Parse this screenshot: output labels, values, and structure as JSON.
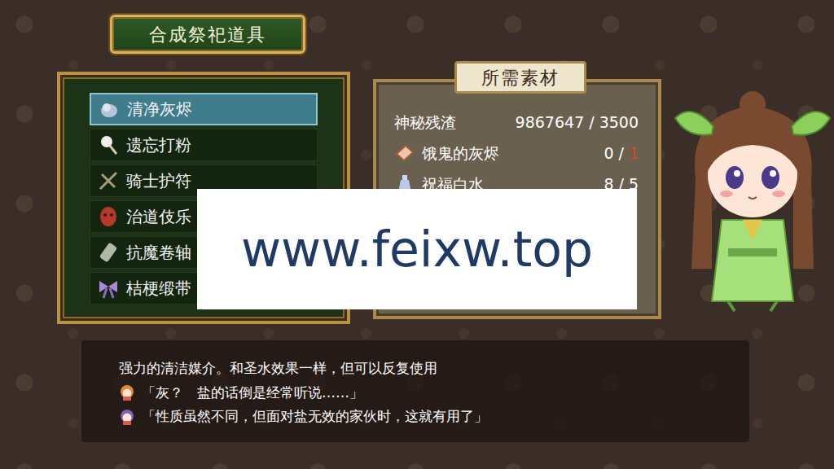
{
  "title": "合成祭祀道具",
  "recipes": [
    {
      "name": "清净灰烬",
      "selected": true
    },
    {
      "name": "遗忘打粉",
      "selected": false
    },
    {
      "name": "骑士护符",
      "selected": false
    },
    {
      "name": "治道伎乐",
      "selected": false
    },
    {
      "name": "抗魔卷轴",
      "selected": false
    },
    {
      "name": "桔梗缎带",
      "selected": false
    }
  ],
  "materials": {
    "title": "所需素材",
    "separator": "/",
    "items": [
      {
        "name": "神秘残渣",
        "kind": "currency",
        "have": "9867647",
        "need": "3500",
        "enough": true
      },
      {
        "name": "饿鬼的灰烬",
        "kind": "item",
        "have": "0",
        "need": "1",
        "enough": false
      },
      {
        "name": "祝福白水",
        "kind": "item",
        "have": "8",
        "need": "5",
        "enough": true
      }
    ]
  },
  "description": {
    "text": "强力的清洁媒介。和圣水效果一样，但可以反复使用",
    "lines": [
      {
        "text": "「灰？　盐的话倒是经常听说……」",
        "color": "#e8862e"
      },
      {
        "text": "「性质虽然不同，但面对盐无效的家伙时，这就有用了」",
        "color": "#7a62b8"
      }
    ]
  },
  "watermark": "www.feixw.top"
}
